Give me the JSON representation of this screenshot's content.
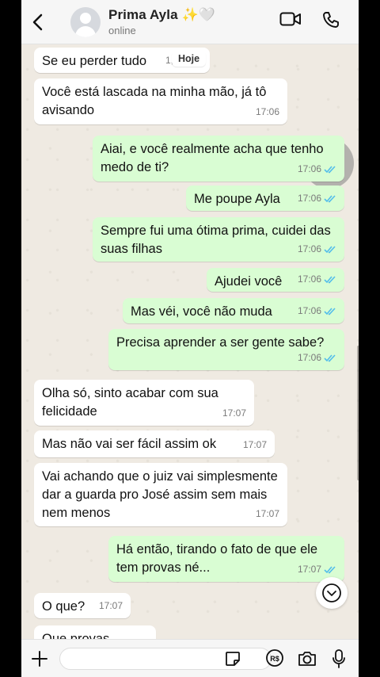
{
  "header": {
    "contact_name": "Prima Ayla ✨🤍",
    "status": "online"
  },
  "date_pill": "Hoje",
  "messages": [
    {
      "dir": "in",
      "text": "Se eu perder tudo",
      "time": "1,"
    },
    {
      "dir": "in",
      "text": "Você está lascada na minha mão, já tô avisando",
      "time": "17:06"
    },
    {
      "dir": "out",
      "text": "Aiai, e você realmente acha que tenho medo de ti?",
      "time": "17:06"
    },
    {
      "dir": "out",
      "text": "Me poupe Ayla",
      "time": "17:06"
    },
    {
      "dir": "out",
      "text": "Sempre fui uma ótima prima, cuidei das suas filhas",
      "time": "17:06"
    },
    {
      "dir": "out",
      "text": "Ajudei você",
      "time": "17:06"
    },
    {
      "dir": "out",
      "text": "Mas véi, você não muda",
      "time": "17:06"
    },
    {
      "dir": "out",
      "text": "Precisa aprender a ser gente sabe?",
      "time": "17:06"
    },
    {
      "dir": "in",
      "text": "Olha só, sinto acabar com sua felicidade",
      "time": "17:07"
    },
    {
      "dir": "in",
      "text": "Mas não vai ser fácil assim ok",
      "time": "17:07"
    },
    {
      "dir": "in",
      "text": "Vai achando que o juiz vai simplesmente dar a guarda pro José assim sem mais nem menos",
      "time": "17:07"
    },
    {
      "dir": "out",
      "text": "Há então, tirando o fato de que ele tem provas né...",
      "time": "17:07"
    },
    {
      "dir": "in",
      "text": "O que?",
      "time": "17:07"
    },
    {
      "dir": "in",
      "text": "Que provas",
      "time": ""
    }
  ],
  "composer": {
    "placeholder": ""
  },
  "icons": {
    "back": "chevron-left-icon",
    "video": "video-call-icon",
    "call": "phone-icon",
    "plus": "plus-icon",
    "sticker": "sticker-icon",
    "payment": "payment-icon",
    "camera": "camera-icon",
    "mic": "microphone-icon",
    "scroll": "chevron-down-icon"
  },
  "colors": {
    "incoming": "#ffffff",
    "outgoing": "#d9fdd3",
    "tick_blue": "#53bdeb"
  }
}
